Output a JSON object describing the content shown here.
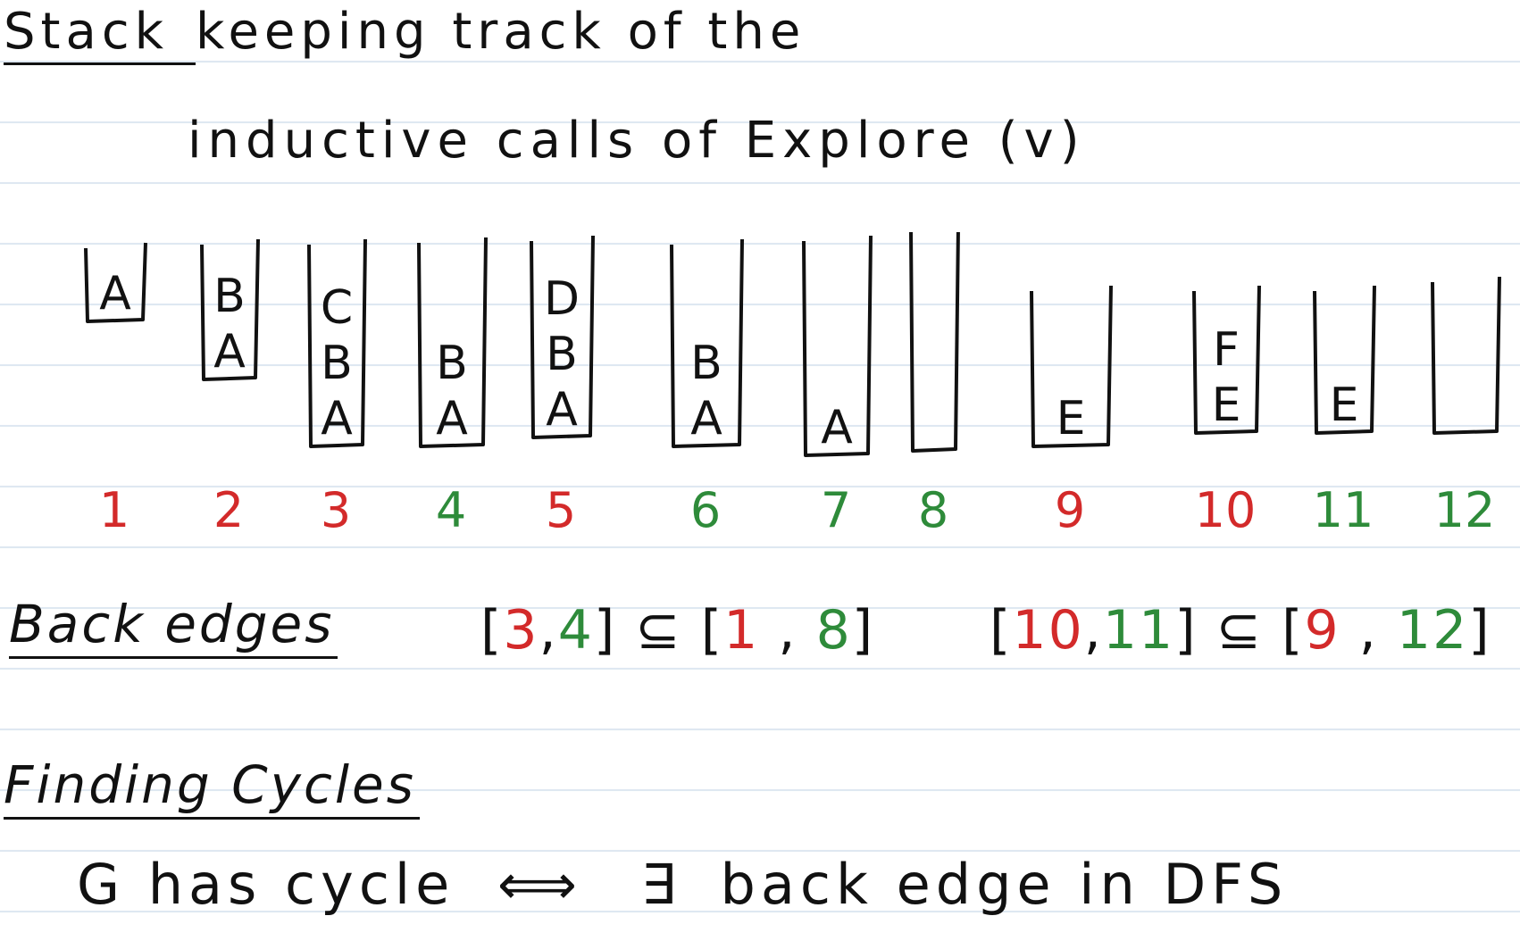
{
  "heading": {
    "line1_word": "Stack",
    "line1_rest": "keeping track of the",
    "line2": "inductive calls of Explore (v)"
  },
  "stacks": [
    {
      "label": "1",
      "items": [
        "A"
      ],
      "color": "red"
    },
    {
      "label": "2",
      "items": [
        "B",
        "A"
      ],
      "color": "red"
    },
    {
      "label": "3",
      "items": [
        "C",
        "B",
        "A"
      ],
      "color": "red"
    },
    {
      "label": "4",
      "items": [
        "B",
        "A"
      ],
      "color": "green"
    },
    {
      "label": "5",
      "items": [
        "D",
        "B",
        "A"
      ],
      "color": "red"
    },
    {
      "label": "6",
      "items": [
        "B",
        "A"
      ],
      "color": "green"
    },
    {
      "label": "7",
      "items": [
        "A"
      ],
      "color": "green"
    },
    {
      "label": "8",
      "items": [],
      "color": "green"
    },
    {
      "label": "9",
      "items": [
        "E"
      ],
      "color": "red"
    },
    {
      "label": "10",
      "items": [
        "F",
        "E"
      ],
      "color": "red"
    },
    {
      "label": "11",
      "items": [
        "E"
      ],
      "color": "green"
    },
    {
      "label": "12",
      "items": [],
      "color": "green"
    }
  ],
  "back_edges": {
    "title": "Back edges",
    "interval1": {
      "a": "3",
      "b": "4",
      "c": "1",
      "d": "8"
    },
    "interval2": {
      "a": "10",
      "b": "11",
      "c": "9",
      "d": "12"
    },
    "subset": "⊆"
  },
  "finding_cycles": {
    "title": "Finding Cycles",
    "lhs": "G has cycle",
    "iff": "⟺",
    "exists": "∃",
    "rhs": "back edge in DFS"
  },
  "colors": {
    "red": "#d32a2a",
    "green": "#2e8b3a",
    "ink": "#111111",
    "rule": "#dce6f0"
  }
}
